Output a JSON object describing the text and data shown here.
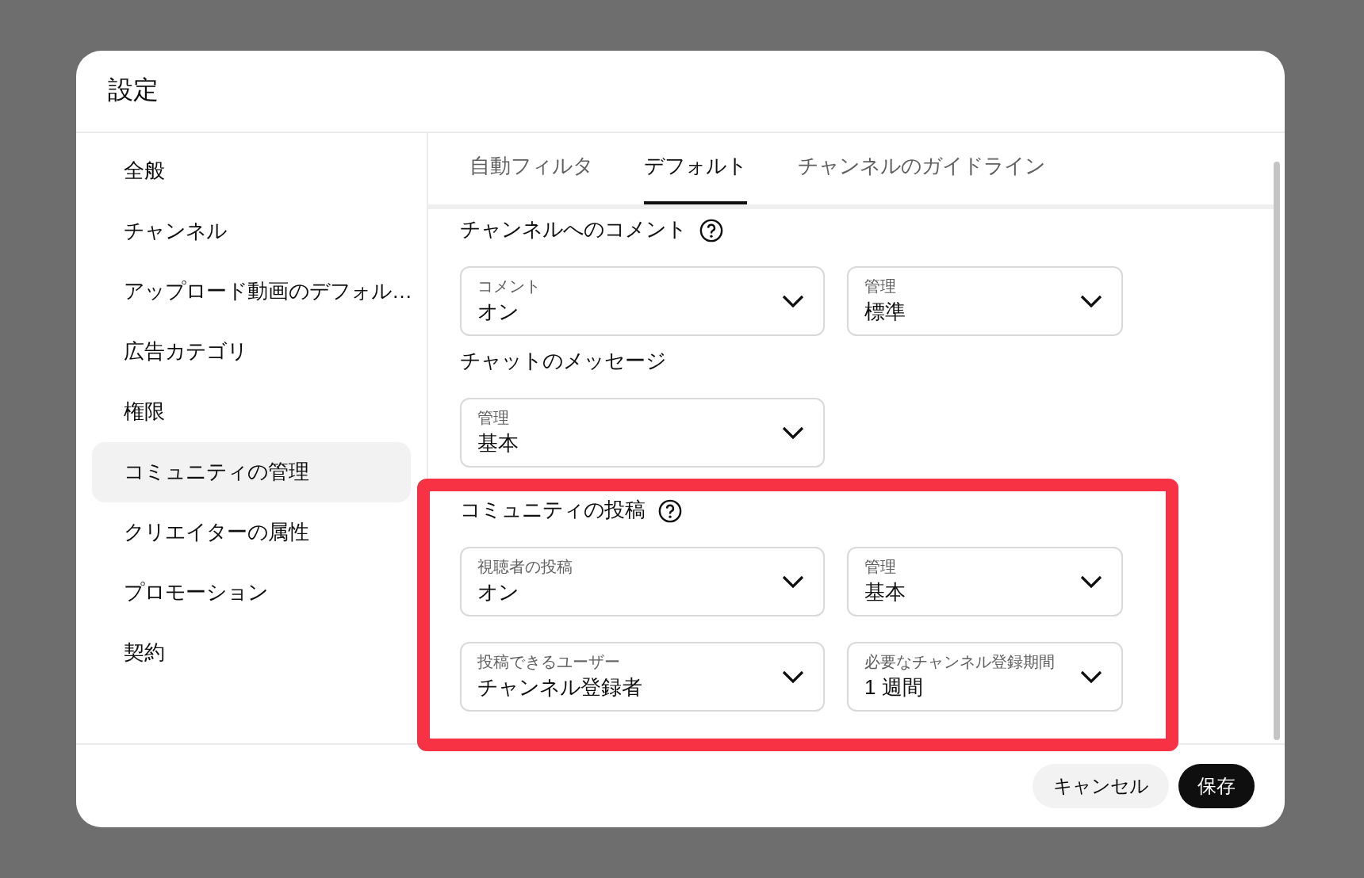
{
  "dialog": {
    "title": "設定"
  },
  "sidebar": {
    "items": [
      {
        "label": "全般",
        "selected": false
      },
      {
        "label": "チャンネル",
        "selected": false
      },
      {
        "label": "アップロード動画のデフォル…",
        "selected": false
      },
      {
        "label": "広告カテゴリ",
        "selected": false
      },
      {
        "label": "権限",
        "selected": false
      },
      {
        "label": "コミュニティの管理",
        "selected": true
      },
      {
        "label": "クリエイターの属性",
        "selected": false
      },
      {
        "label": "プロモーション",
        "selected": false
      },
      {
        "label": "契約",
        "selected": false
      }
    ]
  },
  "tabs": [
    {
      "label": "自動フィルタ",
      "selected": false
    },
    {
      "label": "デフォルト",
      "selected": true
    },
    {
      "label": "チャンネルのガイドライン",
      "selected": false
    }
  ],
  "sections": [
    {
      "heading": "チャンネルへのコメント",
      "help": true,
      "highlighted": false,
      "rows": [
        [
          {
            "label": "コメント",
            "value": "オン"
          },
          {
            "label": "管理",
            "value": "標準"
          }
        ]
      ]
    },
    {
      "heading": "チャットのメッセージ",
      "help": false,
      "highlighted": false,
      "rows": [
        [
          {
            "label": "管理",
            "value": "基本"
          }
        ]
      ]
    },
    {
      "heading": "コミュニティの投稿",
      "help": true,
      "highlighted": true,
      "rows": [
        [
          {
            "label": "視聴者の投稿",
            "value": "オン"
          },
          {
            "label": "管理",
            "value": "基本"
          }
        ],
        [
          {
            "label": "投稿できるユーザー",
            "value": "チャンネル登録者"
          },
          {
            "label": "必要なチャンネル登録期間",
            "value": "1 週間"
          }
        ]
      ]
    }
  ],
  "buttons": [
    {
      "label": "キャンセル",
      "kind": "secondary"
    },
    {
      "label": "保存",
      "kind": "primary"
    }
  ]
}
